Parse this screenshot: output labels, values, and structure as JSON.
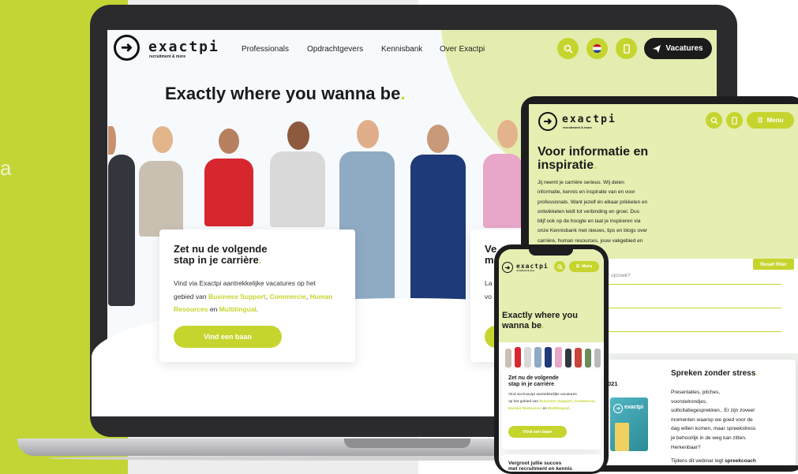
{
  "background": {
    "side_text": "a",
    "colors": {
      "green": "#c2d535",
      "accent": "#c5d52e",
      "dark": "#1b1b1b"
    }
  },
  "laptop": {
    "logo": {
      "word": "exactpi",
      "tagline": "recruitment & more"
    },
    "nav": [
      "Professionals",
      "Opdrachtgevers",
      "Kennisbank",
      "Over Exactpi"
    ],
    "vacatures_label": "Vacatures",
    "hero_title": "Exactly where you wanna be",
    "card": {
      "title_line1": "Zet nu de volgende",
      "title_line2": "stap in je carrière",
      "text_1": "Vind via Exactpi aantrekkelijke vacatures op het",
      "text_2": "gebied van",
      "link_1": "Business Support",
      "link_2": "Commercie",
      "link_3": "Human",
      "link_3b": "Resources",
      "text_en": "en",
      "link_4": "Multilingual",
      "button": "Vind een baan"
    },
    "card2": {
      "title_1": "Ve",
      "title_2": "m",
      "text_1": "La",
      "text_2": "vo"
    }
  },
  "tablet": {
    "logo": {
      "word": "exactpi",
      "tagline": "recruitment & more"
    },
    "menu_label": "Menu",
    "title_line1": "Voor informatie en",
    "title_line2": "inspiratie",
    "body": [
      "Jij neemt je carrière serieus. Wij delen",
      "informatie, kennis en inspiratie van en voor",
      "professionals. Want jezelf én elkaar prikkelen en",
      "ontwikkelen leidt tot verbinding en groei. Dus",
      "blijf ook op de hoogte en laat je inspireren via",
      "onze Kennisbank met nieuws, tips en blogs over",
      "carrière, human resources, jouw vakgebied en"
    ],
    "reset_label": "Reset filter",
    "search_placeholder": "r opzoek?",
    "date_label": "021",
    "webinar": {
      "title": "Spreken zonder stress",
      "body": [
        "Presentaties, pitches,",
        "voorstelrondjes,",
        "sollicitatiegesprekken.. Er zijn zoveel",
        "momenten waarop we goed voor de",
        "dag willen komen, maar spreekstress",
        "je behoorlijk in de weg kan zitten.",
        "Herkenbaar?"
      ],
      "footer_text": "Tijdens dit webinar legt",
      "footer_bold": "spreekcoach"
    }
  },
  "phone": {
    "logo": {
      "word": "exactpi",
      "tagline": "recruitment & more"
    },
    "menu_label": "Menu",
    "hero_line1": "Exactly where you",
    "hero_line2": "wanna be",
    "card": {
      "title_line1": "Zet nu de volgende",
      "title_line2": "stap in je carrière",
      "text_1": "Vind via Exactpi aantrekkelijke vacatures",
      "text_2": "op het gebied van",
      "link_1": "Business Support",
      "link_2": "Commercie",
      "link_3": "Human Resources",
      "text_en": "en",
      "link_4": "Multilingual",
      "button": "Vind een baan"
    },
    "bottom_line1": "Vergroot jullie succes",
    "bottom_line2": "met recruitment en kennis"
  }
}
